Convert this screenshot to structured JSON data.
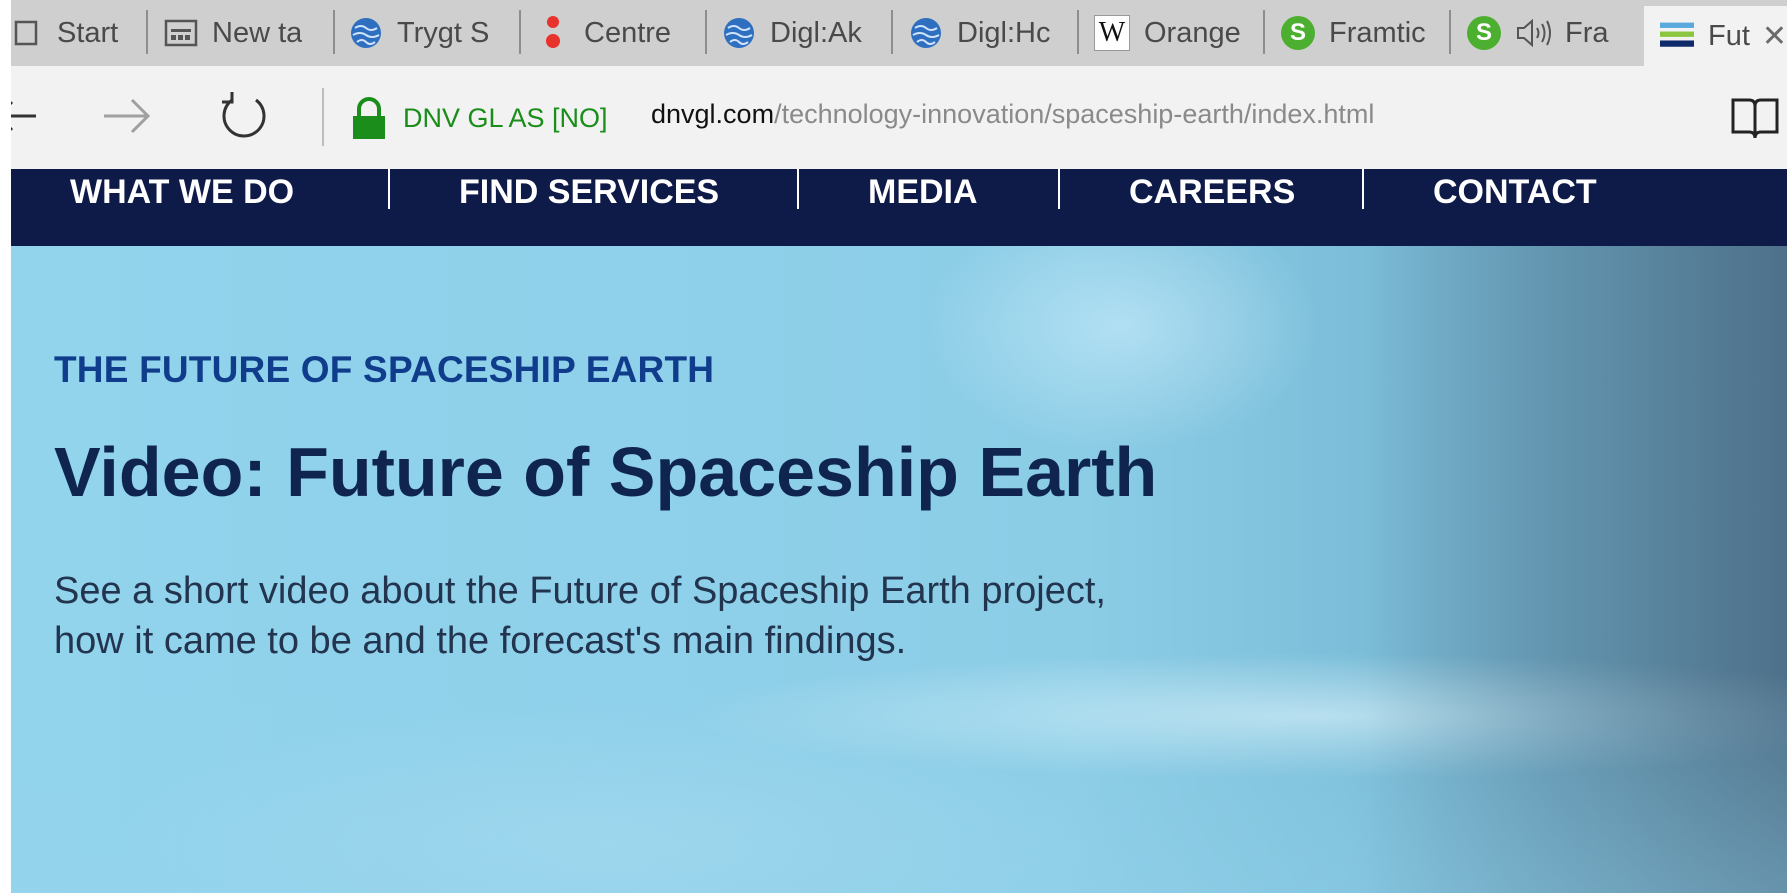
{
  "browser": {
    "tabs": [
      {
        "label": "Start",
        "icon": "page-icon"
      },
      {
        "label": "New ta",
        "icon": "new-tab-page-icon"
      },
      {
        "label": "Trygt S",
        "icon": "globe-icon"
      },
      {
        "label": "Centre",
        "icon": "red-dots-icon"
      },
      {
        "label": "Digl:Ak",
        "icon": "globe-icon"
      },
      {
        "label": "Digl:Hc",
        "icon": "globe-icon"
      },
      {
        "label": "Orange",
        "icon": "wikipedia-icon",
        "icon_text": "W"
      },
      {
        "label": "Framtic",
        "icon": "green-s-icon",
        "icon_text": "S"
      },
      {
        "label": "Fra",
        "icon": "green-s-icon",
        "icon_text": "S",
        "audio": true
      },
      {
        "label": "Fut",
        "icon": "dnv-flag-icon",
        "active": true
      }
    ],
    "address": {
      "site_identity": "DNV GL AS [NO]",
      "host": "dnvgl.com",
      "path": "/technology-innovation/spaceship-earth/index.html"
    },
    "colors": {
      "tabstrip": "#cfcfcf",
      "toolbar": "#f2f2f2",
      "secure_green": "#1a8d1a"
    }
  },
  "site": {
    "nav": [
      "WHAT WE DO",
      "FIND SERVICES",
      "MEDIA",
      "CAREERS",
      "CONTACT"
    ],
    "nav_color": "#0e1b48",
    "hero": {
      "eyebrow": "THE FUTURE OF SPACESHIP EARTH",
      "title": "Video: Future of Spaceship Earth",
      "description_line1": "See a short video about the Future of Spaceship Earth project,",
      "description_line2": "how it came to be and the forecast's main findings."
    }
  }
}
